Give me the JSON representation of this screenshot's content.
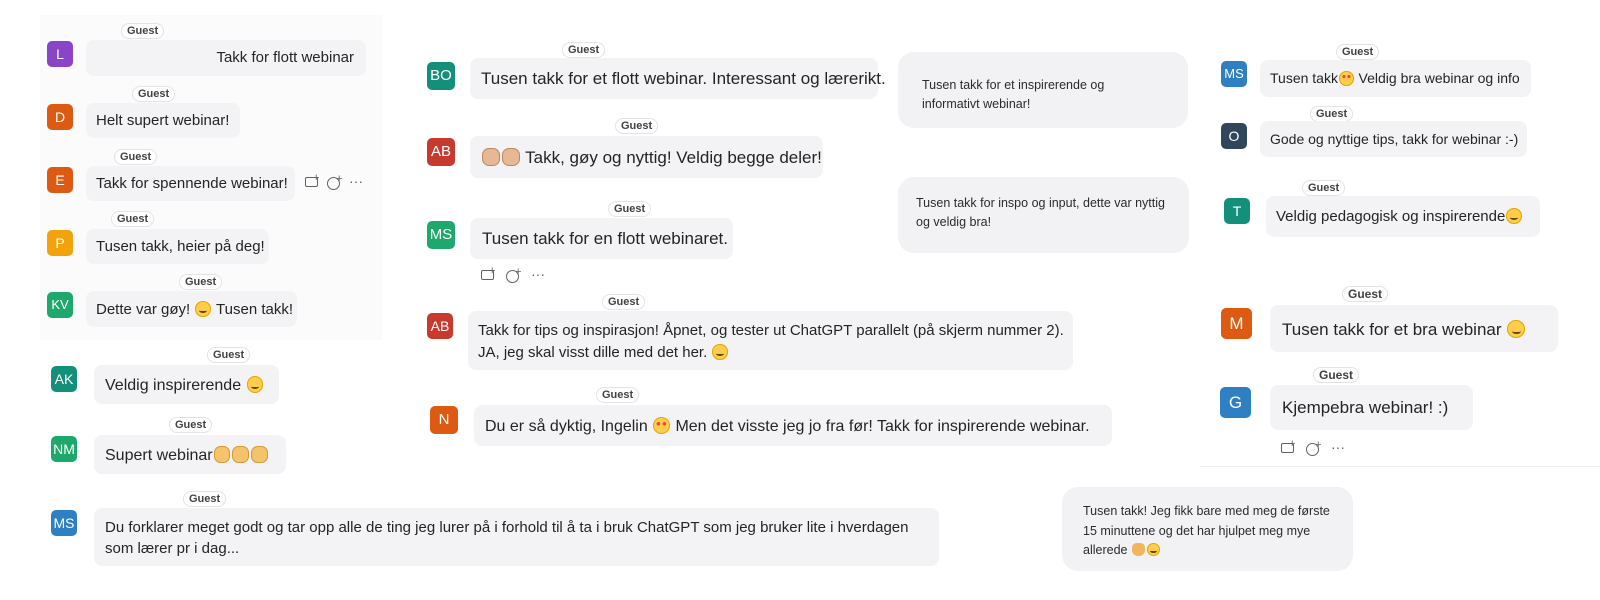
{
  "guest_label": "Guest",
  "colors": {
    "purple": "#8a44c8",
    "orange": "#dc5a12",
    "amber": "#f2a20a",
    "green": "#1fa86c",
    "teal": "#14907a",
    "red": "#c63b2e",
    "blue": "#2f7fc3",
    "slate": "#31465a",
    "bubble": "#f3f3f6"
  },
  "messages": {
    "l": {
      "initials": "L",
      "text": "Takk for flott webinar"
    },
    "d": {
      "initials": "D",
      "text": "Helt supert webinar!"
    },
    "e": {
      "initials": "E",
      "text": "Takk for spennende webinar!"
    },
    "p": {
      "initials": "P",
      "text": "Tusen takk, heier på deg!"
    },
    "kv": {
      "initials": "KV",
      "text_a": "Dette var gøy!",
      "text_b": "Tusen takk!",
      "emoji": "smile"
    },
    "ak": {
      "initials": "AK",
      "text": "Veldig inspirerende",
      "emoji": "grin"
    },
    "nm": {
      "initials": "NM",
      "text": "Supert webinar",
      "emoji": "clap"
    },
    "ms1": {
      "initials": "MS",
      "text": "Du forklarer meget godt og tar opp alle de ting jeg lurer på i forhold til å ta i bruk ChatGPT som jeg bruker lite i hverdagen som lærer pr i dag..."
    },
    "bo": {
      "initials": "BO",
      "text": "Tusen takk for et flott webinar. Interessant og lærerikt."
    },
    "ab1": {
      "initials": "AB",
      "text": "Takk, gøy og nyttig! Veldig begge deler!",
      "emoji": "clap"
    },
    "ms2": {
      "initials": "MS",
      "text": "Tusen takk for en flott webinaret."
    },
    "ab2": {
      "initials": "AB",
      "line1": "Takk for tips og inspirasjon! Åpnet, og tester ut ChatGPT parallelt (på skjerm nummer 2).",
      "line2": "JA, jeg skal visst dille med det her.",
      "emoji": "grin"
    },
    "n": {
      "initials": "N",
      "text_a": "Du er så dyktig, Ingelin",
      "text_b": "Men det visste jeg jo fra før! Takk for inspirerende webinar.",
      "emoji": "heart-eyes"
    },
    "plain1": {
      "text": "Tusen takk for et inspirerende og informativt webinar!"
    },
    "plain2": {
      "text": "Tusen takk for inspo og input, dette var nyttig og veldig bra!"
    },
    "plain3": {
      "text": "Tusen takk! Jeg fikk bare med meg de første 15 minuttene og det har hjulpet meg mye allerede",
      "emoji": "pray-blush"
    },
    "ms3": {
      "initials": "MS",
      "text_a": "Tusen takk",
      "text_b": "Veldig bra webinar og info",
      "emoji": "heart-eyes"
    },
    "o": {
      "initials": "O",
      "text": "Gode og nyttige tips, takk for webinar :-)"
    },
    "t": {
      "initials": "T",
      "text": "Veldig pedagogisk og inspirerende",
      "emoji": "smile"
    },
    "m": {
      "initials": "M",
      "text": "Tusen takk for et bra webinar",
      "emoji": "smile"
    },
    "g": {
      "initials": "G",
      "text": "Kjempebra webinar! :)"
    }
  },
  "actions": {
    "reply_icon": "reply-icon",
    "react_icon": "react-icon",
    "more_icon": "more-options-icon"
  }
}
